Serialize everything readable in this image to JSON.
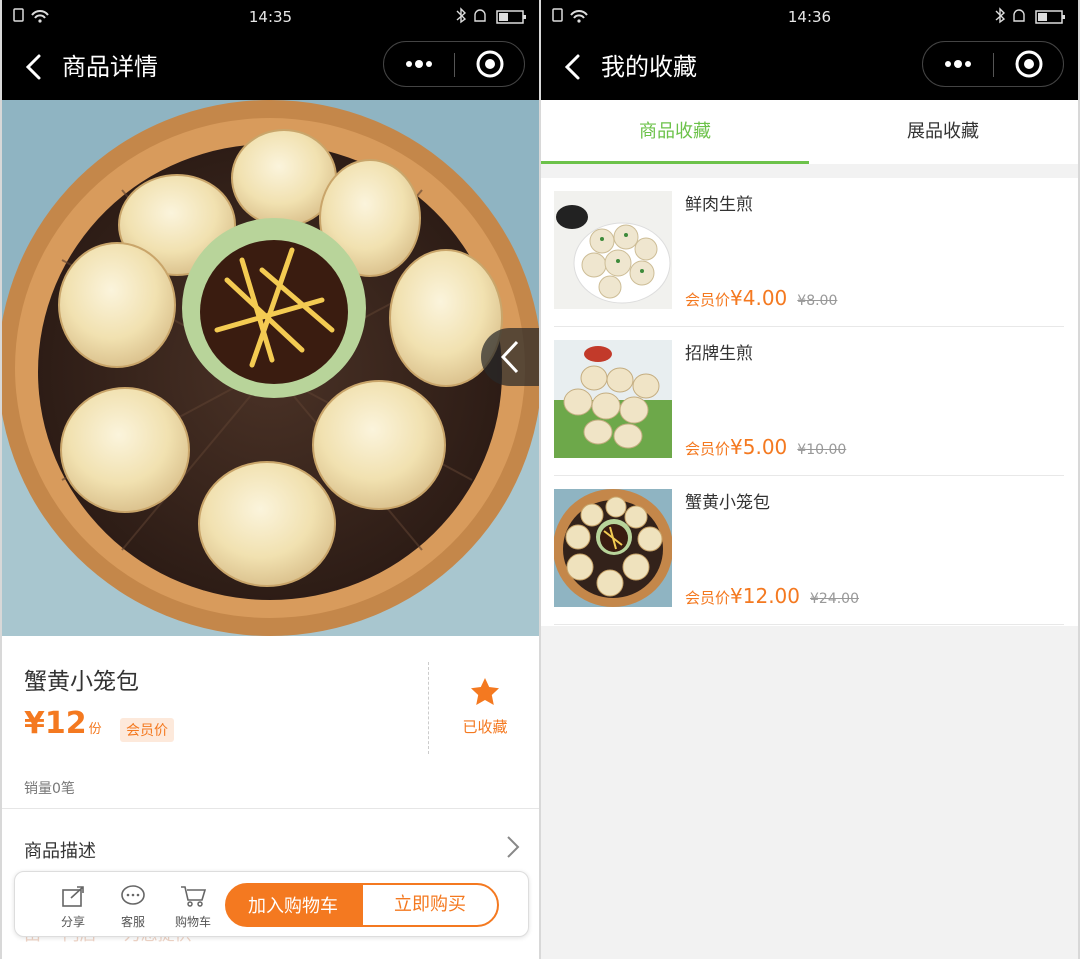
{
  "left": {
    "status": {
      "time": "14:35"
    },
    "nav": {
      "title": "商品详情"
    },
    "product": {
      "name": "蟹黄小笼包",
      "price_symbol": "¥",
      "price": "12",
      "unit": "份",
      "member_tag": "会员价",
      "favorited_label": "已收藏",
      "sales": "销量0笔"
    },
    "description_label": "商品描述",
    "ghost_text": "由 ···门店 ··· 为您提供",
    "bottom_bar": {
      "share": "分享",
      "service": "客服",
      "cart": "购物车",
      "add_to_cart": "加入购物车",
      "buy_now": "立即购买"
    }
  },
  "right": {
    "status": {
      "time": "14:36"
    },
    "nav": {
      "title": "我的收藏"
    },
    "tabs": [
      {
        "label": "商品收藏",
        "active": true
      },
      {
        "label": "展品收藏",
        "active": false
      }
    ],
    "items": [
      {
        "name": "鲜肉生煎",
        "member_label": "会员价",
        "price": "¥4.00",
        "original": "¥8.00"
      },
      {
        "name": "招牌生煎",
        "member_label": "会员价",
        "price": "¥5.00",
        "original": "¥10.00"
      },
      {
        "name": "蟹黄小笼包",
        "member_label": "会员价",
        "price": "¥12.00",
        "original": "¥24.00"
      }
    ]
  },
  "colors": {
    "accent": "#f47920",
    "tab_active": "#6cc24a",
    "navbar": "#000000"
  }
}
